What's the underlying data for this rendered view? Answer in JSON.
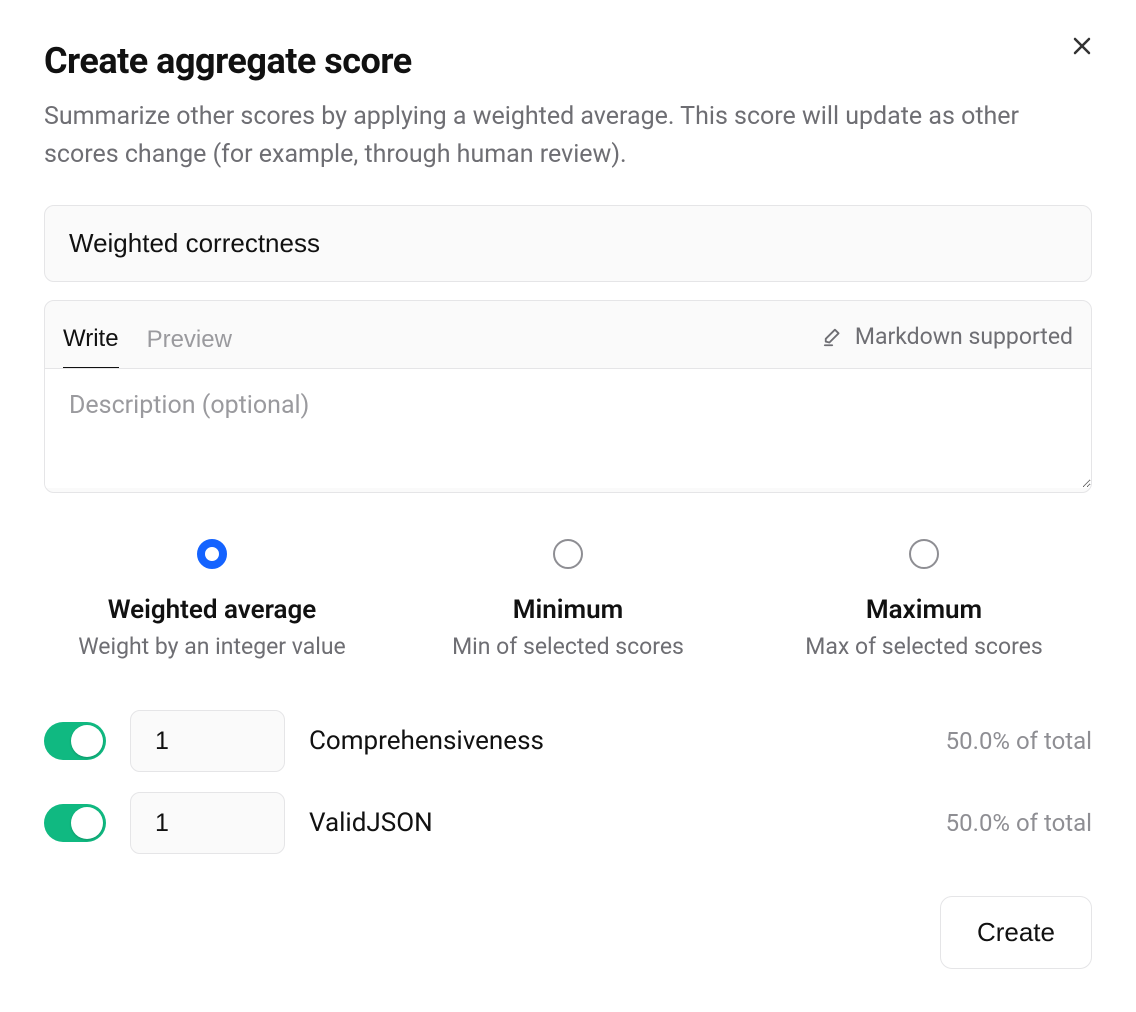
{
  "header": {
    "title": "Create aggregate score",
    "subtitle": "Summarize other scores by applying a weighted average. This score will update as other scores change (for example, through human review)."
  },
  "form": {
    "name_value": "Weighted correctness",
    "desc_tabs": {
      "write": "Write",
      "preview": "Preview"
    },
    "md_hint": "Markdown supported",
    "desc_placeholder": "Description (optional)",
    "desc_value": ""
  },
  "agg_options": [
    {
      "key": "weighted",
      "title": "Weighted average",
      "sub": "Weight by an integer value",
      "selected": true
    },
    {
      "key": "min",
      "title": "Minimum",
      "sub": "Min of selected scores",
      "selected": false
    },
    {
      "key": "max",
      "title": "Maximum",
      "sub": "Max of selected scores",
      "selected": false
    }
  ],
  "scores": [
    {
      "enabled": true,
      "weight": "1",
      "label": "Comprehensiveness",
      "pct": "50.0% of total"
    },
    {
      "enabled": true,
      "weight": "1",
      "label": "ValidJSON",
      "pct": "50.0% of total"
    }
  ],
  "buttons": {
    "create": "Create"
  }
}
